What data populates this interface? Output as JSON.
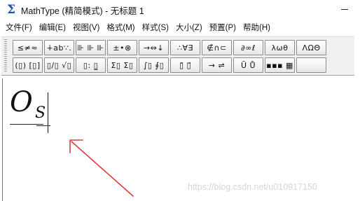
{
  "window": {
    "logo": "Σ",
    "title": "MathType (精简模式) - 无标题 1"
  },
  "menu": [
    "文件(F)",
    "编辑(E)",
    "视图(V)",
    "格式(M)",
    "样式(S)",
    "大小(Z)",
    "预置(P)",
    "帮助(H)"
  ],
  "toolbar": {
    "row1": [
      "≤≠≈",
      "∔ab∵.",
      "⊪ ⊪ ⊪",
      "±•⊗",
      "→⇔↓",
      "∴∀∃",
      "∉∩⊂",
      "∂∞ℓ",
      "λωθ",
      "ΛΩΘ"
    ],
    "row2": [
      "(▯) [▯]",
      "▯/▯ √▯",
      "▯: ▯̲",
      "Σ▯ Σ▯",
      "∫▯ ∮▯",
      "▯̄ ▯⃗",
      "→ ⇌",
      "Ū Ů",
      "▪▪▪ ▦",
      ""
    ]
  },
  "editor": {
    "formula_main": "O",
    "formula_sub": "S"
  },
  "annotation": {
    "arrow_color": "#e0393b"
  },
  "watermark": "https://blog.csdn.net/u010917150",
  "colors": {
    "toolbar_bg": "#f0f0f0",
    "logo_blue": "#1e50b4"
  }
}
